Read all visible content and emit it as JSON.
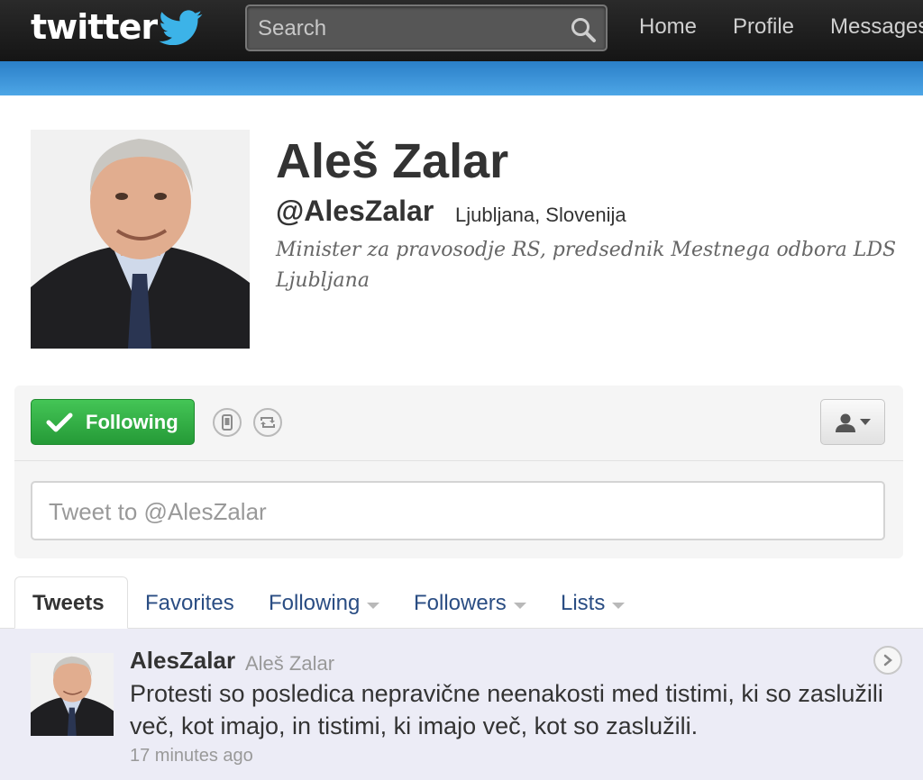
{
  "header": {
    "logo_text": "twitter",
    "search_placeholder": "Search",
    "nav": [
      {
        "label": "Home"
      },
      {
        "label": "Profile"
      },
      {
        "label": "Messages"
      }
    ]
  },
  "profile": {
    "name": "Aleš Zalar",
    "handle": "@AlesZalar",
    "location": "Ljubljana, Slovenija",
    "bio": "Minister za pravosodje RS, predsednik Mestnega odbora LDS Ljubljana"
  },
  "actions": {
    "follow_label": "Following",
    "tweet_placeholder": "Tweet to @AlesZalar"
  },
  "tabs": [
    {
      "label": "Tweets",
      "active": true
    },
    {
      "label": "Favorites"
    },
    {
      "label": "Following"
    },
    {
      "label": "Followers"
    },
    {
      "label": "Lists"
    }
  ],
  "tweets": [
    {
      "username": "AlesZalar",
      "fullname": "Aleš Zalar",
      "text": "Protesti so posledica nepravične neenakosti med tistimi, ki so zaslužili več, kot imajo, in tistimi, ki imajo več, kot so zaslužili.",
      "time": "17 minutes ago"
    }
  ],
  "colors": {
    "topbar": "#1a1a1a",
    "blue_band": "#3a94d8",
    "follow_green": "#2fae43",
    "link_blue": "#2a4d83",
    "tweet_bg": "#ececf6"
  }
}
